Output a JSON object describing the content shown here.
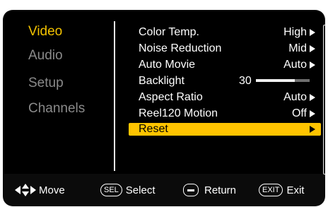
{
  "categories": [
    {
      "label": "Video",
      "active": true
    },
    {
      "label": "Audio",
      "active": false
    },
    {
      "label": "Setup",
      "active": false
    },
    {
      "label": "Channels",
      "active": false
    }
  ],
  "settings": [
    {
      "label": "Color Temp.",
      "value": "High"
    },
    {
      "label": "Noise Reduction",
      "value": "Mid"
    },
    {
      "label": "Auto Movie",
      "value": "Auto"
    },
    {
      "label": "Backlight",
      "value": "30",
      "level": 0.72
    },
    {
      "label": "Aspect Ratio",
      "value": "Auto"
    },
    {
      "label": "Reel120 Motion",
      "value": "Off"
    },
    {
      "label": "Reset",
      "value": "",
      "selected": true
    }
  ],
  "footer": {
    "move_label": "Move",
    "sel_badge": "SEL",
    "select_label": "Select",
    "return_label": "Return",
    "exit_badge": "EXIT",
    "exit_label": "Exit"
  },
  "colors": {
    "accent": "#f2c200",
    "highlight": "#ffc400",
    "inactive": "#8a8a8a"
  }
}
